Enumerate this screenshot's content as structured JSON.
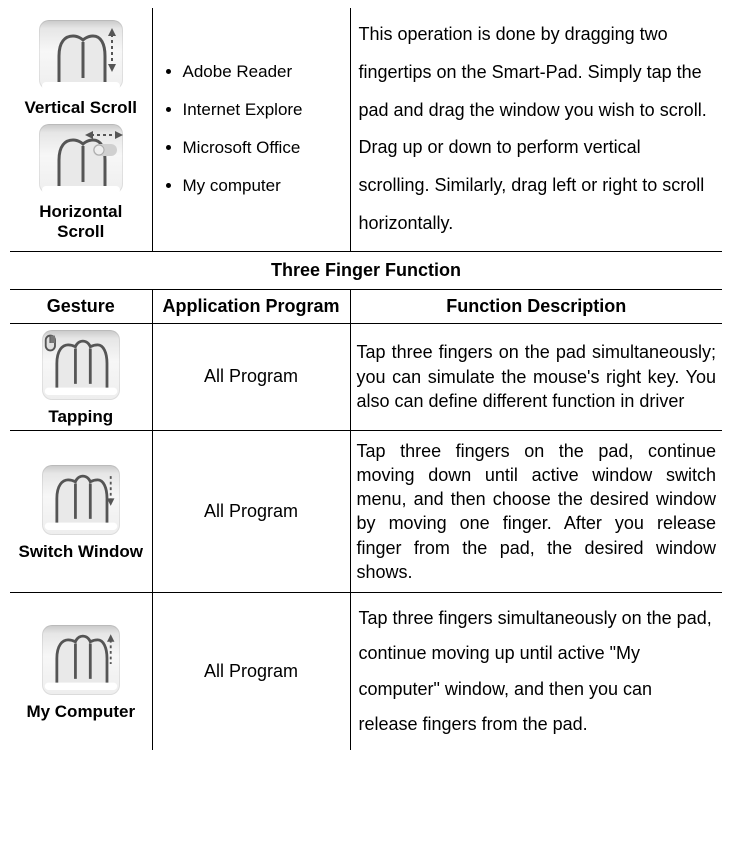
{
  "scroll": {
    "vertical_label": "Vertical Scroll",
    "horizontal_label": "Horizontal Scroll",
    "apps": [
      "Adobe Reader",
      "Internet Explore",
      "Microsoft Office",
      "My computer"
    ],
    "description": "This operation is done by dragging two fingertips on the Smart-Pad. Simply tap the pad and drag the window you wish to scroll. Drag up or down to perform vertical scrolling. Similarly, drag left or right to scroll horizontally."
  },
  "three_finger": {
    "title": "Three Finger Function",
    "headers": {
      "gesture": "Gesture",
      "app": "Application Program",
      "desc": "Function Description"
    },
    "rows": [
      {
        "label": "Tapping",
        "app": "All Program",
        "desc": "Tap three fingers on the pad simultaneously; you can simulate the mouse's right key. You also can define different function in driver"
      },
      {
        "label": "Switch Window",
        "app": "All Program",
        "desc": "Tap three fingers on the pad, continue moving down until active window switch menu, and then choose the desired window by moving one finger. After you release finger from the pad, the desired window shows."
      },
      {
        "label": "My Computer",
        "app": "All Program",
        "desc": "Tap three fingers simultaneously on the pad, continue moving up until active \"My computer\" window, and then you can release fingers from the pad."
      }
    ]
  }
}
